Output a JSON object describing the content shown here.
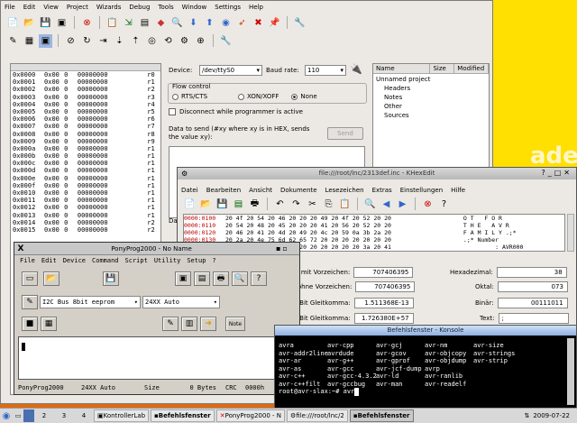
{
  "desktop": {
    "banner_text": "aded"
  },
  "main": {
    "menu": [
      "File",
      "Edit",
      "View",
      "Project",
      "Wizards",
      "Debug",
      "Tools",
      "Window",
      "Settings",
      "Help"
    ],
    "memory_rows": [
      {
        "addr": "0x0000",
        "val": "0x00",
        "dec": "0",
        "bits": "00000000",
        "reg": "r0"
      },
      {
        "addr": "0x0001",
        "val": "0x00",
        "dec": "0",
        "bits": "00000000",
        "reg": "r1"
      },
      {
        "addr": "0x0002",
        "val": "0x00",
        "dec": "0",
        "bits": "00000000",
        "reg": "r2"
      },
      {
        "addr": "0x0003",
        "val": "0x00",
        "dec": "0",
        "bits": "00000000",
        "reg": "r3"
      },
      {
        "addr": "0x0004",
        "val": "0x00",
        "dec": "0",
        "bits": "00000000",
        "reg": "r4"
      },
      {
        "addr": "0x0005",
        "val": "0x00",
        "dec": "0",
        "bits": "00000000",
        "reg": "r5"
      },
      {
        "addr": "0x0006",
        "val": "0x00",
        "dec": "0",
        "bits": "00000000",
        "reg": "r6"
      },
      {
        "addr": "0x0007",
        "val": "0x00",
        "dec": "0",
        "bits": "00000000",
        "reg": "r7"
      },
      {
        "addr": "0x0008",
        "val": "0x00",
        "dec": "0",
        "bits": "00000000",
        "reg": "r8"
      },
      {
        "addr": "0x0009",
        "val": "0x00",
        "dec": "0",
        "bits": "00000000",
        "reg": "r9"
      },
      {
        "addr": "0x000a",
        "val": "0x00",
        "dec": "0",
        "bits": "00000000",
        "reg": "r1"
      },
      {
        "addr": "0x000b",
        "val": "0x00",
        "dec": "0",
        "bits": "00000000",
        "reg": "r1"
      },
      {
        "addr": "0x000c",
        "val": "0x00",
        "dec": "0",
        "bits": "00000000",
        "reg": "r1"
      },
      {
        "addr": "0x000d",
        "val": "0x00",
        "dec": "0",
        "bits": "00000000",
        "reg": "r1"
      },
      {
        "addr": "0x000e",
        "val": "0x00",
        "dec": "0",
        "bits": "00000000",
        "reg": "r1"
      },
      {
        "addr": "0x000f",
        "val": "0x00",
        "dec": "0",
        "bits": "00000000",
        "reg": "r1"
      },
      {
        "addr": "0x0010",
        "val": "0x00",
        "dec": "0",
        "bits": "00000000",
        "reg": "r1"
      },
      {
        "addr": "0x0011",
        "val": "0x00",
        "dec": "0",
        "bits": "00000000",
        "reg": "r1"
      },
      {
        "addr": "0x0012",
        "val": "0x00",
        "dec": "0",
        "bits": "00000000",
        "reg": "r1"
      },
      {
        "addr": "0x0013",
        "val": "0x00",
        "dec": "0",
        "bits": "00000000",
        "reg": "r1"
      },
      {
        "addr": "0x0014",
        "val": "0x00",
        "dec": "0",
        "bits": "00000000",
        "reg": "r2"
      },
      {
        "addr": "0x0015",
        "val": "0x00",
        "dec": "0",
        "bits": "00000000",
        "reg": "r2"
      }
    ],
    "device_label": "Device:",
    "device_value": "/dev/ttyS0",
    "baud_label": "Baud rate:",
    "baud_value": "110",
    "flow_title": "Flow control",
    "flow_rts": "RTS/CTS",
    "flow_xon": "XON/XOFF",
    "flow_none": "None",
    "disconnect_label": "Disconnect while programmer is active",
    "send_label": "Data to send (#xy where xy is in HEX, sends the value xy):",
    "send_button": "Send",
    "dan_fragment": "Dan",
    "project_headers": [
      "Name",
      "Size",
      "Modified"
    ],
    "project_tree": [
      "Unnamed project",
      "Headers",
      "Notes",
      "Other",
      "Sources"
    ]
  },
  "khex": {
    "title": "file:///root/lnc/2313def.inc - KHexEdit",
    "menu": [
      "Datei",
      "Bearbeiten",
      "Ansicht",
      "Dokumente",
      "Lesezeichen",
      "Extras",
      "Einstellungen",
      "Hilfe"
    ],
    "rows": [
      {
        "off": "0000:0100",
        "hex": "20 4f 20 54 20 46 20 20 20 49 20 4f 20 52 20 20",
        "ascii": " O T   F O R"
      },
      {
        "off": "0000:0110",
        "hex": "20 54 20 48 20 45 20 20 20 41 20 56 20 52 20 20",
        "ascii": " T H E   A V R"
      },
      {
        "off": "0000:0120",
        "hex": "20 46 20 41 20 4d 20 49 20 4c 20 59 0a 3b 2a 20",
        "ascii": " F A M I L Y .;*"
      },
      {
        "off": "0000:0130",
        "hex": "20 2a 20 4e 75 6d 62 65 72 20 20 20 20 20 20 20",
        "ascii": " .;* Number"
      },
      {
        "off": "0000:0140",
        "hex": "20 20 20 20 20 20 20 20 20 20 20 20 20 3a 20 41",
        "ascii": "          : AVR000"
      },
      {
        "off": "0000:0150",
        "hex": "2a 20 46 69 6c 65 20 4e 61 6d 65 20 20 20 20 20",
        "ascii": ".;* File Name"
      }
    ],
    "conv": {
      "s32_label": "32-Bit mit Vorzeichen:",
      "s32_val": "707406395",
      "hex_label": "Hexadezimal:",
      "hex_val": "38",
      "u32_label": "32-Bit ohne Vorzeichen:",
      "u32_val": "707406395",
      "oct_label": "Oktal:",
      "oct_val": "073",
      "f32_label": "32-Bit Gleitkomma:",
      "f32_val": "1.511368E-13",
      "bin_label": "Binär:",
      "bin_val": "00111011",
      "f64_label": "64-Bit Gleitkomma:",
      "f64_val": "1.726380E+57",
      "text_label": "Text:",
      "text_val": ";"
    }
  },
  "pony": {
    "title": "PonyProg2000 - No Name",
    "menu": [
      "File",
      "Edit",
      "Device",
      "Command",
      "Script",
      "Utility",
      "Setup",
      "?"
    ],
    "interface": "I2C Bus 8bit eeprom",
    "device": "24XX Auto",
    "note": "Note",
    "status": {
      "app": "PonyProg2000",
      "dev": "24XX Auto",
      "size_label": "Size",
      "size_val": "0 Bytes",
      "crc_label": "CRC",
      "crc_val": "0000h"
    }
  },
  "konsole": {
    "title": "Befehlsfenster - Konsole",
    "lines": [
      [
        "avra",
        "avr-cpp",
        "avr-gcj",
        "avr-nm",
        "avr-size"
      ],
      [
        "avr-addr2line",
        "avrdude",
        "avr-gcov",
        "avr-objcopy",
        "avr-strings"
      ],
      [
        "avr-ar",
        "avr-g++",
        "avr-gprof",
        "avr-objdump",
        "avr-strip"
      ],
      [
        "avr-as",
        "avr-gcc",
        "avr-jcf-dump",
        "avrp",
        ""
      ],
      [
        "avr-c++",
        "avr-gcc-4.3.2",
        "avr-ld",
        "avr-ranlib",
        ""
      ],
      [
        "avr-c++filt",
        "avr-gccbug",
        "avr-man",
        "avr-readelf",
        ""
      ]
    ],
    "prompt": "root@avr-slax:~# avr"
  },
  "taskbar": {
    "workspaces": [
      "2",
      "3",
      "4"
    ],
    "tasks": [
      "KontrollerLab",
      "Befehlsfenster",
      "PonyProg2000 - N",
      "file:///root/lnc/2",
      "Befehlsfenster"
    ],
    "clock": "2009-07-22"
  }
}
